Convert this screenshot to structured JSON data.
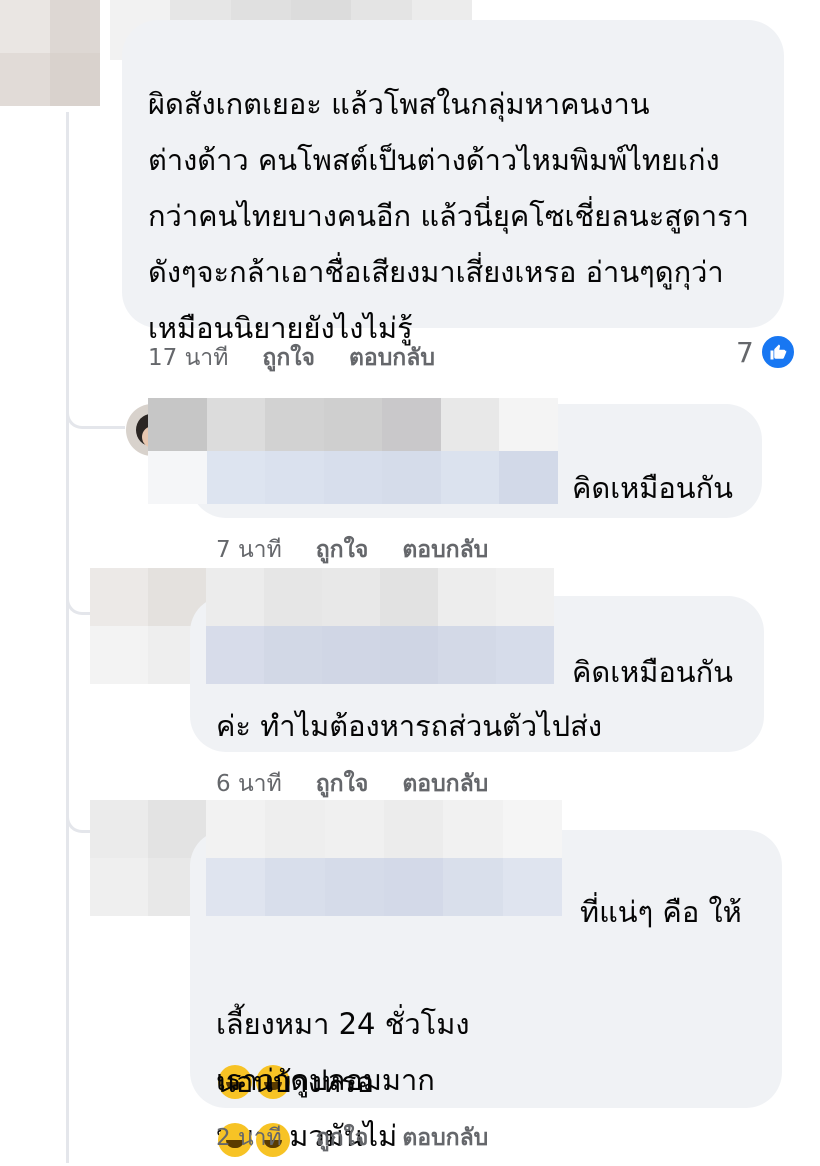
{
  "comments": [
    {
      "text": "ผิดสังเกตเยอะ แล้วโพสในกลุ่มหาคนงาน\nต่างด้าว คนโพสต์เป็นต่างด้าวไหมพิมพ์ไทยเก่ง\nกว่าคนไทยบางคนอีก แล้วนี่ยุคโซเชี่ยลนะสูดารา\nดังๆจะกล้าเอาชื่อเสียงมาเสี่ยงเหรอ อ่านๆดูกุว่า\nเหมือนนิยายยังไงไม่รู้",
      "time": "17 นาที",
      "like": "ถูกใจ",
      "reply": "ตอบกลับ",
      "reaction_count": "7",
      "reaction_icon": "thumbs-up-icon"
    },
    {
      "text": "คิดเหมือนกัน",
      "time": "7 นาที",
      "like": "ถูกใจ",
      "reply": "ตอบกลับ"
    },
    {
      "text_line1": "คิดเหมือนกัน",
      "text_line2": "ค่ะ ทำไมต้องหารถส่วนตัวไปส่ง",
      "time": "6 นาที",
      "like": "ถูกใจ",
      "reply": "ตอบกลับ"
    },
    {
      "text_line1": "ที่แน่ๆ คือ ให้",
      "text_line2_a": "เลี้ยงหมา 24 ชั่วโมง",
      "text_line2_b": "หมาแมวมันไม่",
      "text_line3": "นอนบ้างหรอ",
      "text_line4": "เราว่าดูปลอมมาก",
      "time": "2 นาที",
      "like": "ถูกใจ",
      "reply": "ตอบกลับ"
    }
  ],
  "colors": {
    "bubble": "#f0f2f5",
    "meta": "#65676b",
    "accent": "#1877f2",
    "thread_line": "#e4e6eb"
  }
}
